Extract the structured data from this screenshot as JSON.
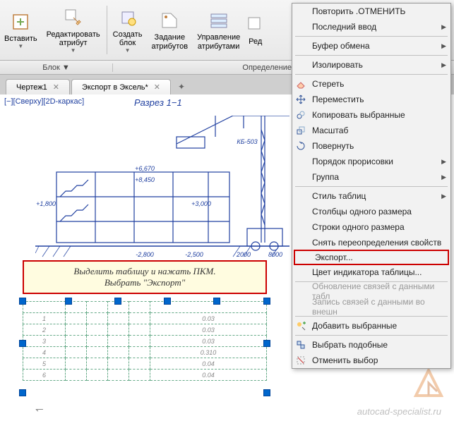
{
  "ribbon": {
    "buttons": [
      {
        "label": "Вставить"
      },
      {
        "label": "Редактировать\nатрибут"
      },
      {
        "label": "Создать\nблок"
      },
      {
        "label": "Задание\nатрибутов"
      },
      {
        "label": "Управление\nатрибутами"
      },
      {
        "label": "Ред"
      }
    ],
    "panels": [
      "Блок ▼",
      "Определение блока ▼"
    ]
  },
  "tabs": {
    "items": [
      {
        "name": "Чертеж1",
        "active": false
      },
      {
        "name": "Экспорт в Эксель*",
        "active": true
      }
    ]
  },
  "viewport": {
    "label": "[−][Сверху][2D-каркас]",
    "title": "Разрез 1−1",
    "crane_label": "КБ-503",
    "elevations": [
      "+6,670",
      "+8,450",
      "+1,800",
      "+3,000",
      "-2,800",
      "-2,500"
    ],
    "dims": [
      "2000",
      "8000"
    ]
  },
  "callout": {
    "line1": "Выделить таблицу и нажать ПКМ.",
    "line2": "Выбрать \"Экспорт\""
  },
  "table": {
    "rows": 7,
    "cols": 6
  },
  "context_menu": {
    "items": [
      {
        "label": "Повторить .ОТМЕНИТЬ",
        "type": "item"
      },
      {
        "label": "Последний ввод",
        "type": "item",
        "submenu": true
      },
      {
        "type": "sep"
      },
      {
        "label": "Буфер обмена",
        "type": "item",
        "submenu": true
      },
      {
        "type": "sep"
      },
      {
        "label": "Изолировать",
        "type": "item",
        "submenu": true
      },
      {
        "type": "sep"
      },
      {
        "label": "Стереть",
        "type": "item",
        "icon": "erase"
      },
      {
        "label": "Переместить",
        "type": "item",
        "icon": "move"
      },
      {
        "label": "Копировать выбранные",
        "type": "item",
        "icon": "copy"
      },
      {
        "label": "Масштаб",
        "type": "item",
        "icon": "scale"
      },
      {
        "label": "Повернуть",
        "type": "item",
        "icon": "rotate"
      },
      {
        "label": "Порядок прорисовки",
        "type": "item",
        "submenu": true
      },
      {
        "label": "Группа",
        "type": "item",
        "submenu": true
      },
      {
        "type": "sep"
      },
      {
        "label": "Стиль таблиц",
        "type": "item",
        "submenu": true
      },
      {
        "label": "Столбцы одного размера",
        "type": "item"
      },
      {
        "label": "Строки одного размера",
        "type": "item"
      },
      {
        "label": "Снять переопределения свойств",
        "type": "item"
      },
      {
        "label": "Экспорт...",
        "type": "item",
        "highlight": true
      },
      {
        "label": "Цвет индикатора таблицы...",
        "type": "item"
      },
      {
        "type": "sep"
      },
      {
        "label": "Обновление связей с данными табл",
        "type": "item",
        "disabled": true
      },
      {
        "label": "Запись связей с данными во внешн",
        "type": "item",
        "disabled": true
      },
      {
        "type": "sep"
      },
      {
        "label": "Добавить выбранные",
        "type": "item",
        "icon": "add-sel"
      },
      {
        "type": "sep"
      },
      {
        "label": "Выбрать подобные",
        "type": "item",
        "icon": "similar"
      },
      {
        "label": "Отменить выбор",
        "type": "item",
        "icon": "deselect"
      }
    ]
  },
  "watermark": "autocad-specialist.ru"
}
